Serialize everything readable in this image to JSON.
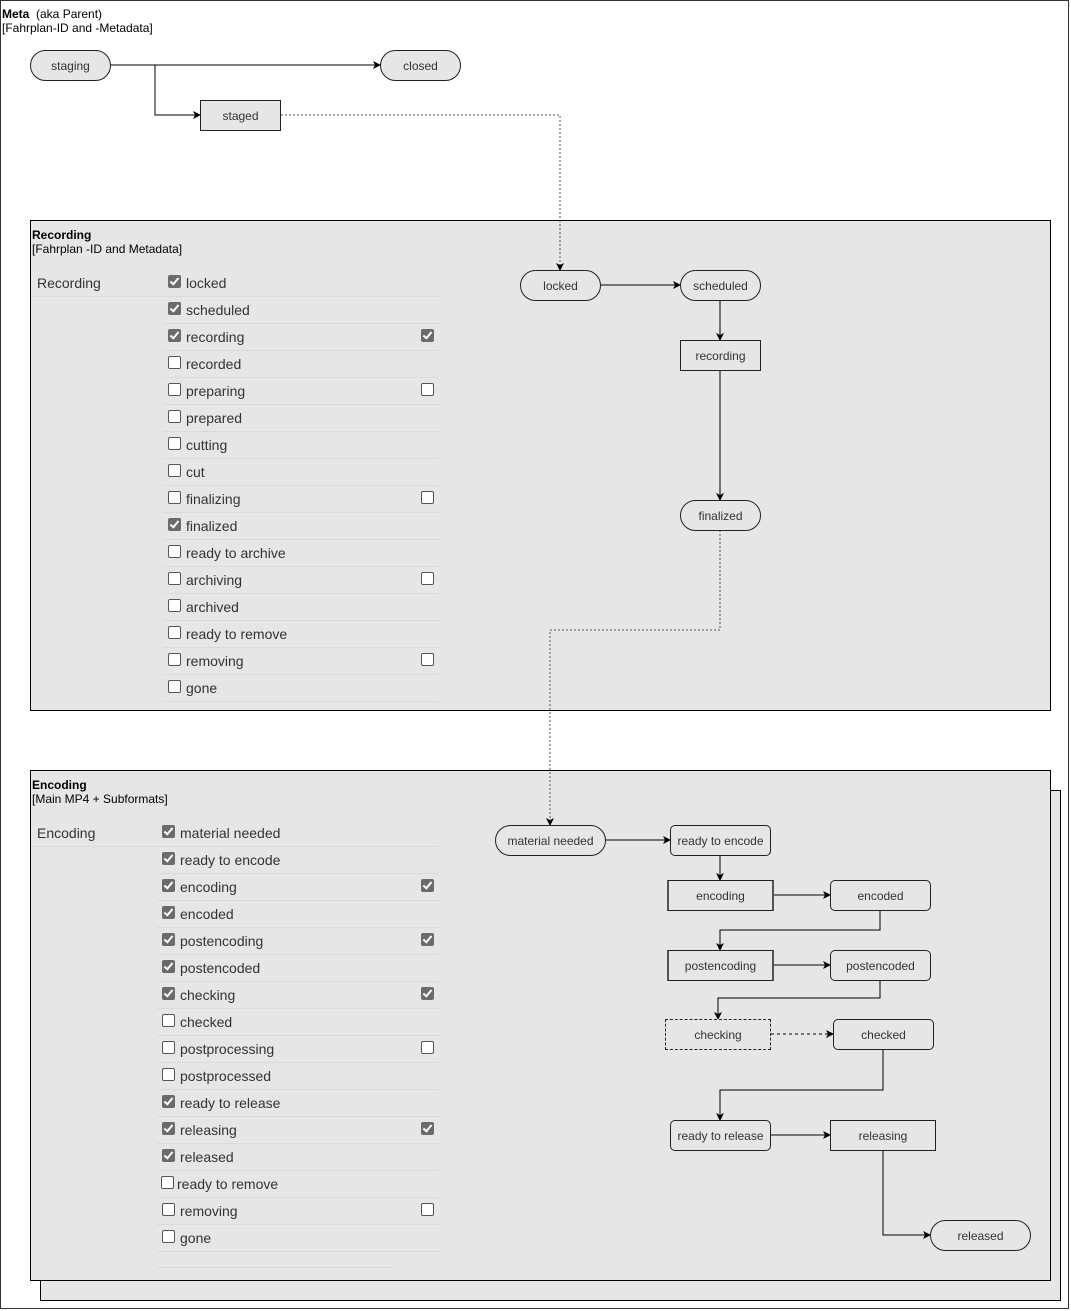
{
  "meta": {
    "title_bold": "Meta",
    "title_rest": "  (aka Parent)",
    "subtitle": "[Fahrplan-ID and -Metadata]",
    "nodes": {
      "staging": "staging",
      "closed": "closed",
      "staged": "staged"
    }
  },
  "recording": {
    "title": "Recording",
    "subtitle": "[Fahrplan -ID and Metadata]",
    "side_label": "Recording",
    "states": [
      {
        "label": "locked",
        "checked": true,
        "extra": null
      },
      {
        "label": "scheduled",
        "checked": true,
        "extra": null
      },
      {
        "label": "recording",
        "checked": true,
        "extra": true
      },
      {
        "label": "recorded",
        "checked": false,
        "extra": null
      },
      {
        "label": "preparing",
        "checked": false,
        "extra": false
      },
      {
        "label": "prepared",
        "checked": false,
        "extra": null
      },
      {
        "label": "cutting",
        "checked": false,
        "extra": null
      },
      {
        "label": "cut",
        "checked": false,
        "extra": null
      },
      {
        "label": "finalizing",
        "checked": false,
        "extra": false
      },
      {
        "label": "finalized",
        "checked": true,
        "extra": null
      },
      {
        "label": "ready to archive",
        "checked": false,
        "extra": null
      },
      {
        "label": "archiving",
        "checked": false,
        "extra": false
      },
      {
        "label": "archived",
        "checked": false,
        "extra": null
      },
      {
        "label": "ready to remove",
        "checked": false,
        "extra": null
      },
      {
        "label": "removing",
        "checked": false,
        "extra": false
      },
      {
        "label": "gone",
        "checked": false,
        "extra": null
      }
    ],
    "nodes": {
      "locked": "locked",
      "scheduled": "scheduled",
      "recording": "recording",
      "finalized": "finalized"
    }
  },
  "encoding": {
    "title": "Encoding",
    "subtitle": "[Main MP4 + Subformats]",
    "side_label": "Encoding",
    "states": [
      {
        "label": "material needed",
        "checked": true,
        "extra": null
      },
      {
        "label": "ready to encode",
        "checked": true,
        "extra": null
      },
      {
        "label": "encoding",
        "checked": true,
        "extra": true
      },
      {
        "label": "encoded",
        "checked": true,
        "extra": null
      },
      {
        "label": "postencoding",
        "checked": true,
        "extra": true
      },
      {
        "label": "postencoded",
        "checked": true,
        "extra": null
      },
      {
        "label": "checking",
        "checked": true,
        "extra": true
      },
      {
        "label": "checked",
        "checked": false,
        "extra": null
      },
      {
        "label": "postprocessing",
        "checked": false,
        "extra": false
      },
      {
        "label": "postprocessed",
        "checked": false,
        "extra": null
      },
      {
        "label": "ready to release",
        "checked": true,
        "extra": null
      },
      {
        "label": "releasing",
        "checked": true,
        "extra": true
      },
      {
        "label": "released",
        "checked": true,
        "extra": null
      },
      {
        "label": "ready to remove",
        "checked": false,
        "extra": null
      },
      {
        "label": "removing",
        "checked": false,
        "extra": false
      },
      {
        "label": "gone",
        "checked": false,
        "extra": null
      }
    ],
    "nodes": {
      "material_needed": "material needed",
      "ready_to_encode": "ready to encode",
      "encoding": "encoding",
      "encoded": "encoded",
      "postencoding": "postencoding",
      "postencoded": "postencoded",
      "checking": "checking",
      "checked": "checked",
      "ready_to_release": "ready to release",
      "releasing": "releasing",
      "released": "released"
    }
  },
  "colors": {
    "panel_bg": "#e6e6e6",
    "checkbox_on": "#6b6b6b",
    "line": "#000000",
    "dotted_line": "#555555"
  }
}
